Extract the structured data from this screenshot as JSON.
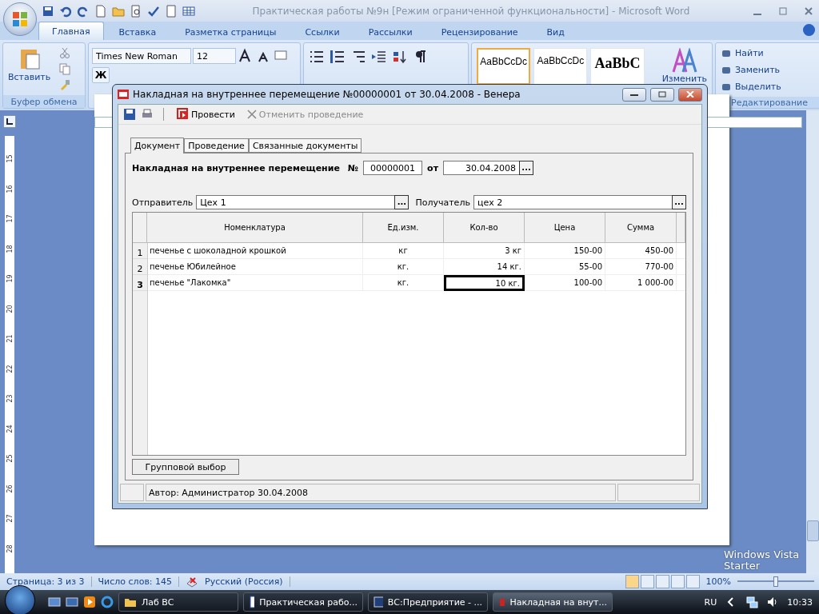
{
  "word_window": {
    "title": "Практическая работы №9н [Режим ограниченной функциональности] - Microsoft Word",
    "ribbon_tabs": [
      {
        "label": "Главная",
        "selected": true
      },
      {
        "label": "Вставка",
        "selected": false
      },
      {
        "label": "Разметка страницы",
        "selected": false
      },
      {
        "label": "Ссылки",
        "selected": false
      },
      {
        "label": "Рассылки",
        "selected": false
      },
      {
        "label": "Рецензирование",
        "selected": false
      },
      {
        "label": "Вид",
        "selected": false
      }
    ],
    "ribbon": {
      "paste_label": "Вставить",
      "clipboard_group": "Буфер обмена",
      "font_name": "Times New Roman",
      "font_size": "12",
      "bold_key": "Ж",
      "styles": [
        {
          "preview": "AaBbCcDc",
          "kind": "normal",
          "selected": true
        },
        {
          "preview": "AaBbCcDc",
          "kind": "normal",
          "selected": false
        },
        {
          "preview": "AaBbC",
          "kind": "heading",
          "selected": false
        }
      ],
      "change_styles": "Изменить",
      "editing": [
        "Найти",
        "Заменить",
        "Выделить"
      ],
      "editing_group": "Редактирование"
    },
    "vertical_ruler": [
      "15",
      "16",
      "17",
      "18",
      "19",
      "20",
      "21",
      "22",
      "23",
      "24",
      "25",
      "26",
      "27",
      "28"
    ],
    "status_bar": {
      "page": "Страница: 3 из 3",
      "words": "Число слов: 145",
      "language": "Русский (Россия)",
      "zoom": "100%",
      "zoom_slider": {
        "level": 0.5
      }
    }
  },
  "dialog": {
    "title": "Накладная на внутреннее перемещение №00000001 от 30.04.2008 - Венера",
    "toolbar": [
      {
        "label": "Провести",
        "disabled": false
      },
      {
        "label": "Отменить проведение",
        "disabled": true
      }
    ],
    "tabs": [
      {
        "label": "Документ",
        "selected": true
      },
      {
        "label": "Проведение",
        "selected": false
      },
      {
        "label": "Связанные документы",
        "selected": false
      }
    ],
    "heading": "Накладная на внутреннее перемещение",
    "number_label": "№",
    "number": "00000001",
    "date_label": "от",
    "date": "30.04.2008",
    "picker": "...",
    "sender_label": "Отправитель",
    "sender": "Цех 1",
    "recipient_label": "Получатель",
    "recipient": "цех 2",
    "table": {
      "columns": [
        "Номенклатура",
        "Ед.изм.",
        "Кол-во",
        "Цена",
        "Сумма"
      ],
      "rows": [
        {
          "number": "1",
          "selected": false,
          "cells": [
            {
              "text": "печенье с шоколадной крошкой",
              "focused": false
            },
            {
              "text": "кг",
              "focused": false
            },
            {
              "text": "3 кг",
              "focused": false
            },
            {
              "text": "150-00",
              "focused": false
            },
            {
              "text": "450-00",
              "focused": false
            }
          ]
        },
        {
          "number": "2",
          "selected": false,
          "cells": [
            {
              "text": "печенье Юбилейное",
              "focused": false
            },
            {
              "text": "кг.",
              "focused": false
            },
            {
              "text": "14 кг.",
              "focused": false
            },
            {
              "text": "55-00",
              "focused": false
            },
            {
              "text": "770-00",
              "focused": false
            }
          ]
        },
        {
          "number": "3",
          "selected": true,
          "cells": [
            {
              "text": "печенье \"Лакомка\"",
              "focused": false
            },
            {
              "text": "кг.",
              "focused": false
            },
            {
              "text": "10 кг.",
              "focused": true
            },
            {
              "text": "100-00",
              "focused": false
            },
            {
              "text": "1 000-00",
              "focused": false
            }
          ]
        }
      ]
    },
    "group_button": "Групповой выбор",
    "status": "Автор: Администратор 30.04.2008"
  },
  "taskbar": {
    "buttons": [
      {
        "label": "Лаб ВС",
        "selected": false,
        "kind": "folder"
      },
      {
        "label": "Практическая рабо...",
        "selected": false,
        "kind": "word"
      },
      {
        "label": "ВС:Предприятие - ...",
        "selected": false,
        "kind": "app"
      },
      {
        "label": "Накладная на внут...",
        "selected": true,
        "kind": "doc"
      }
    ],
    "language": "RU",
    "clock": "10:33"
  },
  "os_watermark": [
    "Windows Vista",
    "Starter"
  ]
}
